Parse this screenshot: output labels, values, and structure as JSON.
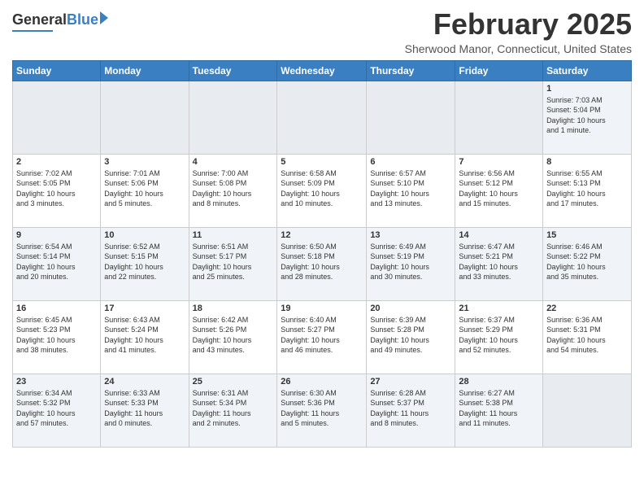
{
  "logo": {
    "general": "General",
    "blue": "Blue"
  },
  "title": {
    "month_year": "February 2025",
    "location": "Sherwood Manor, Connecticut, United States"
  },
  "days_of_week": [
    "Sunday",
    "Monday",
    "Tuesday",
    "Wednesday",
    "Thursday",
    "Friday",
    "Saturday"
  ],
  "weeks": [
    [
      {
        "day": "",
        "info": ""
      },
      {
        "day": "",
        "info": ""
      },
      {
        "day": "",
        "info": ""
      },
      {
        "day": "",
        "info": ""
      },
      {
        "day": "",
        "info": ""
      },
      {
        "day": "",
        "info": ""
      },
      {
        "day": "1",
        "info": "Sunrise: 7:03 AM\nSunset: 5:04 PM\nDaylight: 10 hours\nand 1 minute."
      }
    ],
    [
      {
        "day": "2",
        "info": "Sunrise: 7:02 AM\nSunset: 5:05 PM\nDaylight: 10 hours\nand 3 minutes."
      },
      {
        "day": "3",
        "info": "Sunrise: 7:01 AM\nSunset: 5:06 PM\nDaylight: 10 hours\nand 5 minutes."
      },
      {
        "day": "4",
        "info": "Sunrise: 7:00 AM\nSunset: 5:08 PM\nDaylight: 10 hours\nand 8 minutes."
      },
      {
        "day": "5",
        "info": "Sunrise: 6:58 AM\nSunset: 5:09 PM\nDaylight: 10 hours\nand 10 minutes."
      },
      {
        "day": "6",
        "info": "Sunrise: 6:57 AM\nSunset: 5:10 PM\nDaylight: 10 hours\nand 13 minutes."
      },
      {
        "day": "7",
        "info": "Sunrise: 6:56 AM\nSunset: 5:12 PM\nDaylight: 10 hours\nand 15 minutes."
      },
      {
        "day": "8",
        "info": "Sunrise: 6:55 AM\nSunset: 5:13 PM\nDaylight: 10 hours\nand 17 minutes."
      }
    ],
    [
      {
        "day": "9",
        "info": "Sunrise: 6:54 AM\nSunset: 5:14 PM\nDaylight: 10 hours\nand 20 minutes."
      },
      {
        "day": "10",
        "info": "Sunrise: 6:52 AM\nSunset: 5:15 PM\nDaylight: 10 hours\nand 22 minutes."
      },
      {
        "day": "11",
        "info": "Sunrise: 6:51 AM\nSunset: 5:17 PM\nDaylight: 10 hours\nand 25 minutes."
      },
      {
        "day": "12",
        "info": "Sunrise: 6:50 AM\nSunset: 5:18 PM\nDaylight: 10 hours\nand 28 minutes."
      },
      {
        "day": "13",
        "info": "Sunrise: 6:49 AM\nSunset: 5:19 PM\nDaylight: 10 hours\nand 30 minutes."
      },
      {
        "day": "14",
        "info": "Sunrise: 6:47 AM\nSunset: 5:21 PM\nDaylight: 10 hours\nand 33 minutes."
      },
      {
        "day": "15",
        "info": "Sunrise: 6:46 AM\nSunset: 5:22 PM\nDaylight: 10 hours\nand 35 minutes."
      }
    ],
    [
      {
        "day": "16",
        "info": "Sunrise: 6:45 AM\nSunset: 5:23 PM\nDaylight: 10 hours\nand 38 minutes."
      },
      {
        "day": "17",
        "info": "Sunrise: 6:43 AM\nSunset: 5:24 PM\nDaylight: 10 hours\nand 41 minutes."
      },
      {
        "day": "18",
        "info": "Sunrise: 6:42 AM\nSunset: 5:26 PM\nDaylight: 10 hours\nand 43 minutes."
      },
      {
        "day": "19",
        "info": "Sunrise: 6:40 AM\nSunset: 5:27 PM\nDaylight: 10 hours\nand 46 minutes."
      },
      {
        "day": "20",
        "info": "Sunrise: 6:39 AM\nSunset: 5:28 PM\nDaylight: 10 hours\nand 49 minutes."
      },
      {
        "day": "21",
        "info": "Sunrise: 6:37 AM\nSunset: 5:29 PM\nDaylight: 10 hours\nand 52 minutes."
      },
      {
        "day": "22",
        "info": "Sunrise: 6:36 AM\nSunset: 5:31 PM\nDaylight: 10 hours\nand 54 minutes."
      }
    ],
    [
      {
        "day": "23",
        "info": "Sunrise: 6:34 AM\nSunset: 5:32 PM\nDaylight: 10 hours\nand 57 minutes."
      },
      {
        "day": "24",
        "info": "Sunrise: 6:33 AM\nSunset: 5:33 PM\nDaylight: 11 hours\nand 0 minutes."
      },
      {
        "day": "25",
        "info": "Sunrise: 6:31 AM\nSunset: 5:34 PM\nDaylight: 11 hours\nand 2 minutes."
      },
      {
        "day": "26",
        "info": "Sunrise: 6:30 AM\nSunset: 5:36 PM\nDaylight: 11 hours\nand 5 minutes."
      },
      {
        "day": "27",
        "info": "Sunrise: 6:28 AM\nSunset: 5:37 PM\nDaylight: 11 hours\nand 8 minutes."
      },
      {
        "day": "28",
        "info": "Sunrise: 6:27 AM\nSunset: 5:38 PM\nDaylight: 11 hours\nand 11 minutes."
      },
      {
        "day": "",
        "info": ""
      }
    ]
  ]
}
